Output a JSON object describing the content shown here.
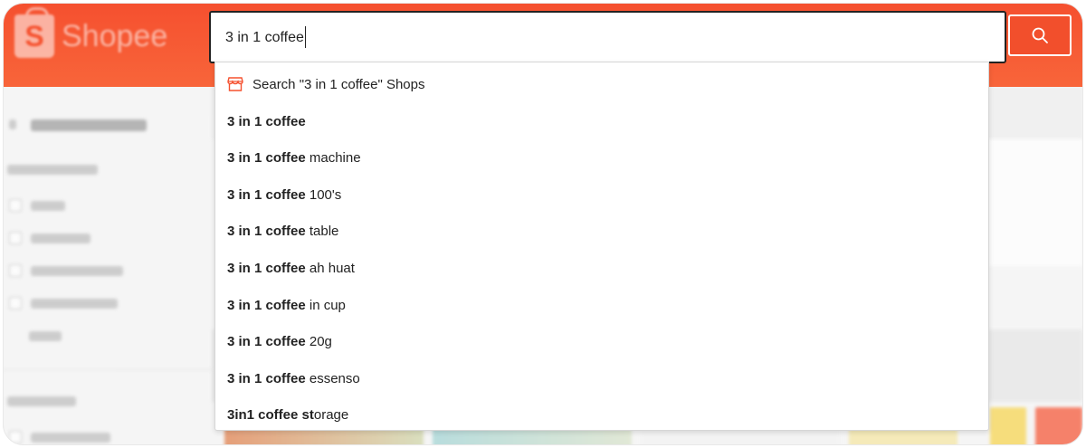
{
  "header": {
    "logo_text": "Shopee",
    "logo_mark": "S"
  },
  "search": {
    "value": "3 in 1 coffee",
    "button_icon": "search-icon"
  },
  "dropdown": {
    "shop_item": {
      "icon": "shop-icon",
      "label": "Search \"3 in 1 coffee\" Shops"
    },
    "suggestions": [
      {
        "bold": "3 in 1 coffee",
        "rest": ""
      },
      {
        "bold": "3 in 1 coffee",
        "rest": " machine"
      },
      {
        "bold": "3 in 1 coffee",
        "rest": " 100's"
      },
      {
        "bold": "3 in 1 coffee",
        "rest": " table"
      },
      {
        "bold": "3 in 1 coffee",
        "rest": " ah huat"
      },
      {
        "bold": "3 in 1 coffee",
        "rest": " in cup"
      },
      {
        "bold": "3 in 1 coffee",
        "rest": " 20g"
      },
      {
        "bold": "3 in 1 coffee",
        "rest": " essenso"
      },
      {
        "bold": "3in1 coffee st",
        "rest": "orage"
      }
    ]
  },
  "colors": {
    "brand": "#f5502f",
    "button": "#f24f2c",
    "text": "#222222"
  }
}
